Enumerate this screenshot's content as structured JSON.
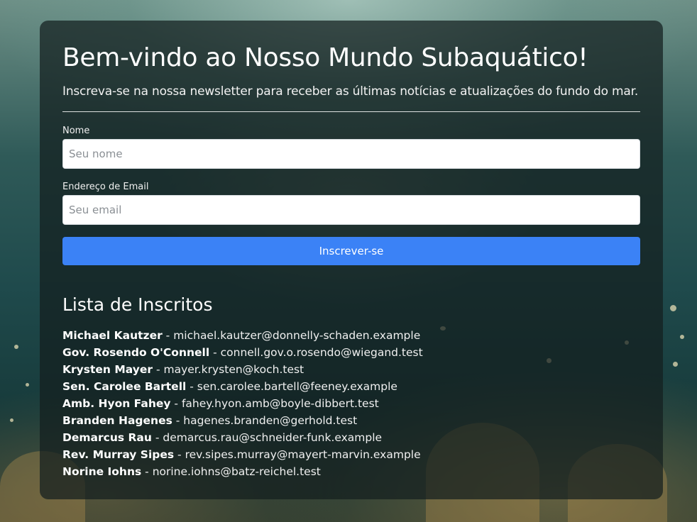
{
  "header": {
    "title": "Bem-vindo ao Nosso Mundo Subaquático!",
    "subtitle": "Inscreva-se na nossa newsletter para receber as últimas notícias e atualizações do fundo do mar."
  },
  "form": {
    "name_label": "Nome",
    "name_placeholder": "Seu nome",
    "name_value": "",
    "email_label": "Endereço de Email",
    "email_placeholder": "Seu email",
    "email_value": "",
    "submit_label": "Inscrever-se"
  },
  "subscribers": {
    "title": "Lista de Inscritos",
    "separator": " - ",
    "items": [
      {
        "name": "Michael Kautzer",
        "email": "michael.kautzer@donnelly-schaden.example"
      },
      {
        "name": "Gov. Rosendo O'Connell",
        "email": "connell.gov.o.rosendo@wiegand.test"
      },
      {
        "name": "Krysten Mayer",
        "email": "mayer.krysten@koch.test"
      },
      {
        "name": "Sen. Carolee Bartell",
        "email": "sen.carolee.bartell@feeney.example"
      },
      {
        "name": "Amb. Hyon Fahey",
        "email": "fahey.hyon.amb@boyle-dibbert.test"
      },
      {
        "name": "Branden Hagenes",
        "email": "hagenes.branden@gerhold.test"
      },
      {
        "name": "Demarcus Rau",
        "email": "demarcus.rau@schneider-funk.example"
      },
      {
        "name": "Rev. Murray Sipes",
        "email": "rev.sipes.murray@mayert-marvin.example"
      },
      {
        "name": "Norine Iohns",
        "email": "norine.iohns@batz-reichel.test"
      }
    ]
  },
  "colors": {
    "accent": "#3b82f6",
    "card_background": "rgba(20, 30, 30, 0.72)"
  }
}
